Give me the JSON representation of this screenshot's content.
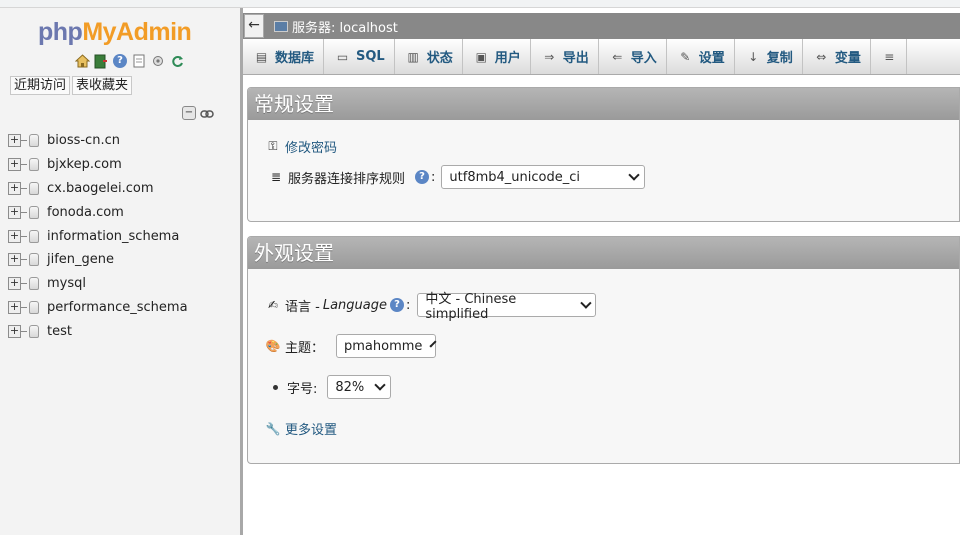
{
  "logo": {
    "part1": "php",
    "part2": "MyAdmin"
  },
  "nav": {
    "links": [
      "近期访问",
      "表收藏夹"
    ],
    "databases": [
      "bioss-cn.cn",
      "bjxkep.com",
      "cx.baogelei.com",
      "fonoda.com",
      "information_schema",
      "jifen_gene",
      "mysql",
      "performance_schema",
      "test"
    ]
  },
  "breadcrumb": {
    "label": "服务器: localhost"
  },
  "tabs": [
    {
      "label": "数据库",
      "icon": "database-icon"
    },
    {
      "label": "SQL",
      "icon": "sql-icon"
    },
    {
      "label": "状态",
      "icon": "status-icon"
    },
    {
      "label": "用户",
      "icon": "users-icon"
    },
    {
      "label": "导出",
      "icon": "export-icon"
    },
    {
      "label": "导入",
      "icon": "import-icon"
    },
    {
      "label": "设置",
      "icon": "settings-icon"
    },
    {
      "label": "复制",
      "icon": "replication-icon"
    },
    {
      "label": "变量",
      "icon": "variables-icon"
    }
  ],
  "general": {
    "title": "常规设置",
    "change_password": "修改密码",
    "collation_label": "服务器连接排序规则",
    "collation_value": "utf8mb4_unicode_ci"
  },
  "appearance": {
    "title": "外观设置",
    "language_label": "语言 - ",
    "language_label_en": "Language",
    "language_value": "中文 - Chinese simplified",
    "theme_label": "主题：",
    "theme_value": "pmahomme",
    "fontsize_label": "字号:",
    "fontsize_value": "82%",
    "more_settings": "更多设置"
  },
  "colors": {
    "link": "#235a81",
    "panel_header": "#a8a8a8",
    "logo_php": "#6c78af",
    "logo_admin": "#f29c26"
  }
}
